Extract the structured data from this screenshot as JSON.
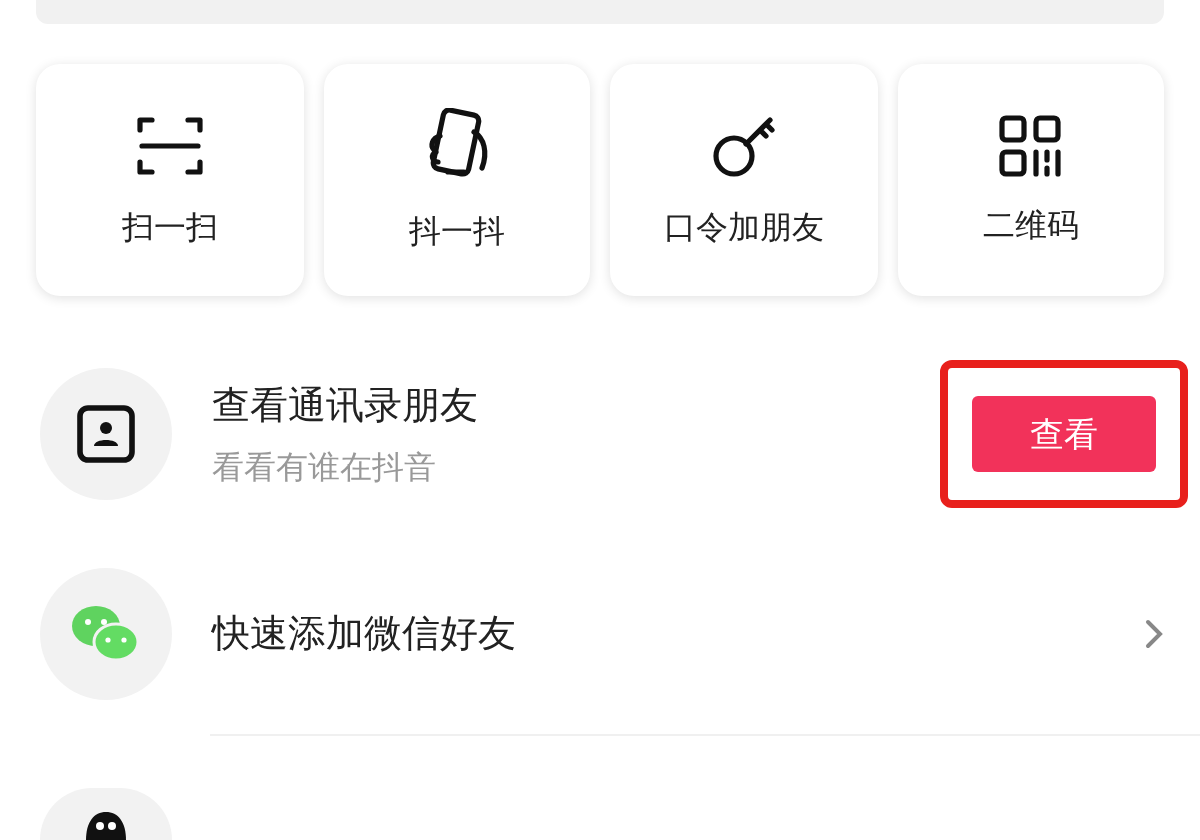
{
  "quick_actions": [
    {
      "kind": "scan",
      "label": "扫一扫"
    },
    {
      "kind": "shake",
      "label": "抖一抖"
    },
    {
      "kind": "key",
      "label": "口令加朋友"
    },
    {
      "kind": "qr",
      "label": "二维码"
    }
  ],
  "rows": [
    {
      "kind": "contacts",
      "title": "查看通讯录朋友",
      "subtitle": "看看有谁在抖音",
      "action": {
        "label": "查看",
        "highlighted": true
      }
    },
    {
      "kind": "wechat",
      "title": "快速添加微信好友",
      "chevron": true
    },
    {
      "kind": "qq"
    }
  ]
}
